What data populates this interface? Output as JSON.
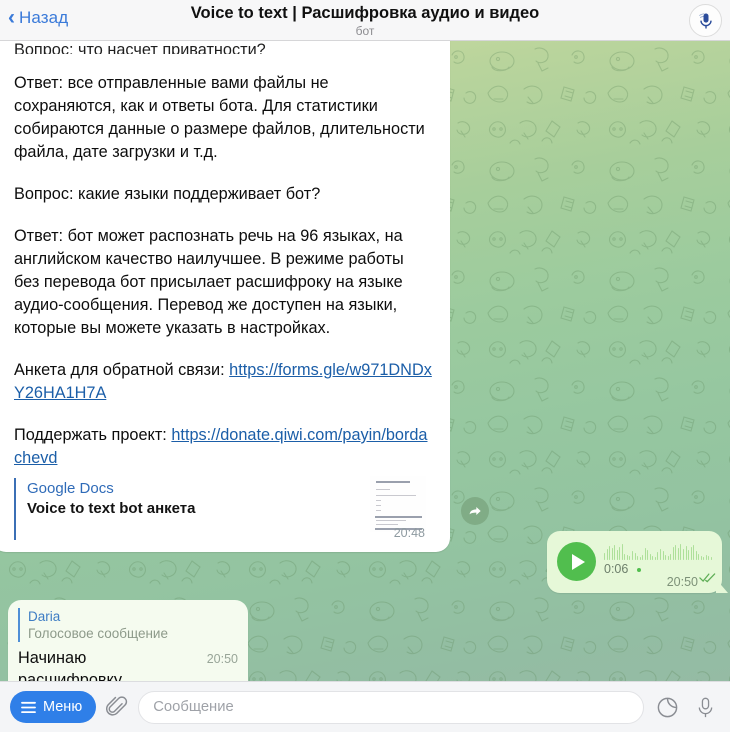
{
  "header": {
    "back_label": "Назад",
    "back_icon": "chevron-left-icon",
    "title": "Voice to text | Расшифровка аудио и видео",
    "subtitle": "бот",
    "avatar_icon": "microphone-icon"
  },
  "colors": {
    "accent_blue": "#2f7fe8",
    "link_blue": "#1b5ea8",
    "outgoing_bubble": "#e6f8d8",
    "incoming_bubble": "#ffffff",
    "play_green": "#51be4e",
    "background_top": "#cfdda0",
    "background_bottom": "#95bba4"
  },
  "messages": {
    "bot_message": {
      "paragraph_clipped": "Вопрос: что насчет приватности?",
      "paragraphs": [
        "Ответ: все отправленные вами файлы не сохраняются, как и ответы бота. Для статистики собираются данные о размере файлов, длительности файла, дате загрузки и т.д.",
        "Вопрос: какие языки поддерживает бот?",
        "Ответ: бот может распознать речь на 96 языках, на английском качество наилучшее. В режиме работы без перевода бот присылает расшифроку на языке аудио-сообщения. Перевод же доступен на языки, которые вы можете указать в настройках."
      ],
      "feedback_label": "Анкета для обратной связи: ",
      "feedback_link": "https://forms.gle/w971DNDxY26HA1H7A",
      "donate_label": "Поддержать проект: ",
      "donate_link": "https://donate.qiwi.com/payin/bordachevd",
      "link_preview": {
        "site": "Google Docs",
        "title": "Voice to text bot анкета",
        "thumbnail_icon": "document-thumbnail"
      },
      "time": "20:48",
      "forward_icon": "forward-arrow-icon"
    },
    "voice_message": {
      "play_icon": "play-icon",
      "duration": "0:06",
      "unread_dot": true,
      "time": "20:50",
      "status_icon": "double-check-icon",
      "waveform": [
        7,
        11,
        14,
        12,
        15,
        10,
        13,
        16,
        6,
        5,
        4,
        9,
        7,
        4,
        3,
        5,
        12,
        10,
        6,
        4,
        3,
        8,
        11,
        9,
        5,
        4,
        6,
        13,
        15,
        12,
        16,
        11,
        14,
        10,
        13,
        15,
        9,
        6,
        4,
        3,
        5,
        4,
        3
      ]
    },
    "reply_message": {
      "quote_name": "Daria",
      "quote_text": "Голосовое сообщение",
      "text": "Начинаю расшифровку...",
      "time": "20:50"
    }
  },
  "composer": {
    "menu_label": "Меню",
    "menu_icon": "hamburger-icon",
    "attach_icon": "paperclip-icon",
    "input_placeholder": "Сообщение",
    "sticker_icon": "sticker-icon",
    "mic_icon": "microphone-icon"
  }
}
